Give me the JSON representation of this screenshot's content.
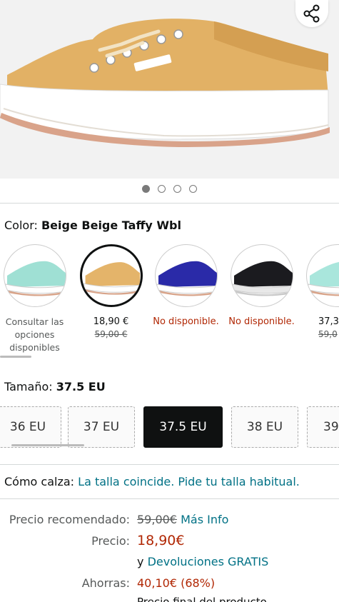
{
  "product": {
    "dots_count": 4,
    "active_dot": 0
  },
  "color": {
    "label": "Color:",
    "value": "Beige Beige Taffy Wbl",
    "swatches": [
      {
        "label": "Consultar las opciones disponibles",
        "shoe_color": "#9fe0d4"
      },
      {
        "price": "18,90 €",
        "old_price": "59,00 €",
        "shoe_color": "#e4b46a",
        "selected": true
      },
      {
        "status": "No disponible.",
        "shoe_color": "#2a2aa8"
      },
      {
        "status": "No disponible.",
        "shoe_color": "#1b1b1f"
      },
      {
        "price": "37,3",
        "old_price": "59,0",
        "shoe_color": "#a9e6dc"
      }
    ]
  },
  "size": {
    "label": "Tamaño:",
    "value": "37.5 EU",
    "options": [
      "36 EU",
      "37 EU",
      "37.5 EU",
      "38 EU",
      "39"
    ]
  },
  "fit": {
    "label": "Cómo calza:",
    "value": "La talla coincide. Pide tu talla habitual."
  },
  "pricing": {
    "recommended_label": "Precio recomendado:",
    "recommended_value": "59,00€",
    "more_info": "Más Info",
    "price_label": "Precio:",
    "price_value": "18,90€",
    "returns_prefix": "y",
    "returns_link": "Devoluciones GRATIS",
    "savings_label": "Ahorras:",
    "savings_value": "40,10€ (68%)",
    "cut_text": "Precio final del producto"
  },
  "colors": {
    "link": "#007185",
    "price_red": "#b12704",
    "selected_bg": "#0f1111"
  },
  "icons": {
    "share": "share-icon"
  }
}
